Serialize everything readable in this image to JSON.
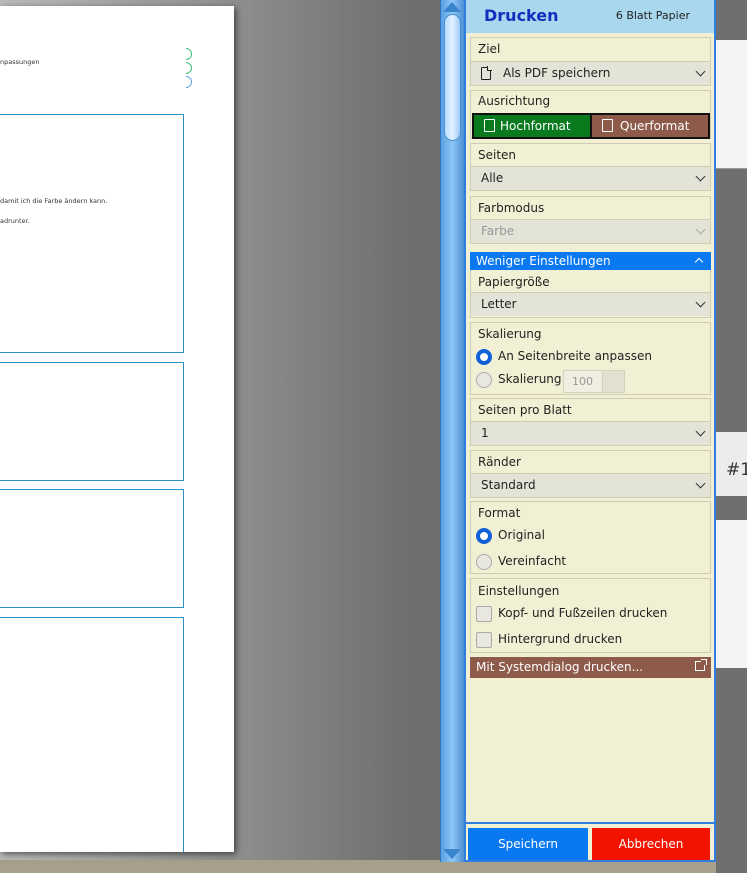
{
  "preview": {
    "lines": [
      "npassungen",
      "damit ich die Farbe ändern kann.",
      "adrunter."
    ]
  },
  "background_app": {
    "hash_label": "#1"
  },
  "panel": {
    "title": "Drucken",
    "sheet_count": "6 Blatt Papier",
    "target": {
      "label": "Ziel",
      "value": "Als PDF speichern"
    },
    "orientation": {
      "label": "Ausrichtung",
      "portrait": "Hochformat",
      "landscape": "Querformat"
    },
    "pages": {
      "label": "Seiten",
      "value": "Alle"
    },
    "color_mode": {
      "label": "Farbmodus",
      "value": "Farbe"
    },
    "fewer_settings": "Weniger Einstellungen",
    "paper_size": {
      "label": "Papiergröße",
      "value": "Letter"
    },
    "scaling": {
      "label": "Skalierung",
      "fit_width": "An Seitenbreite anpassen",
      "custom": "Skalierung",
      "custom_value": "100"
    },
    "pages_per_sheet": {
      "label": "Seiten pro Blatt",
      "value": "1"
    },
    "margins": {
      "label": "Ränder",
      "value": "Standard"
    },
    "format": {
      "label": "Format",
      "original": "Original",
      "simplified": "Vereinfacht"
    },
    "settings": {
      "label": "Einstellungen",
      "headers_footers": "Kopf- und Fußzeilen drucken",
      "background": "Hintergrund drucken"
    },
    "system_dialog": "Mit Systemdialog drucken...",
    "save": "Speichern",
    "cancel": "Abbrechen"
  },
  "colors": {
    "accent": "#0a78f0",
    "portrait_btn": "#0a7a1e",
    "landscape_btn": "#8e5a4a",
    "cancel_btn": "#f21400",
    "panel_bg": "#f2f0d4",
    "header_bg": "#a9d8ee"
  }
}
